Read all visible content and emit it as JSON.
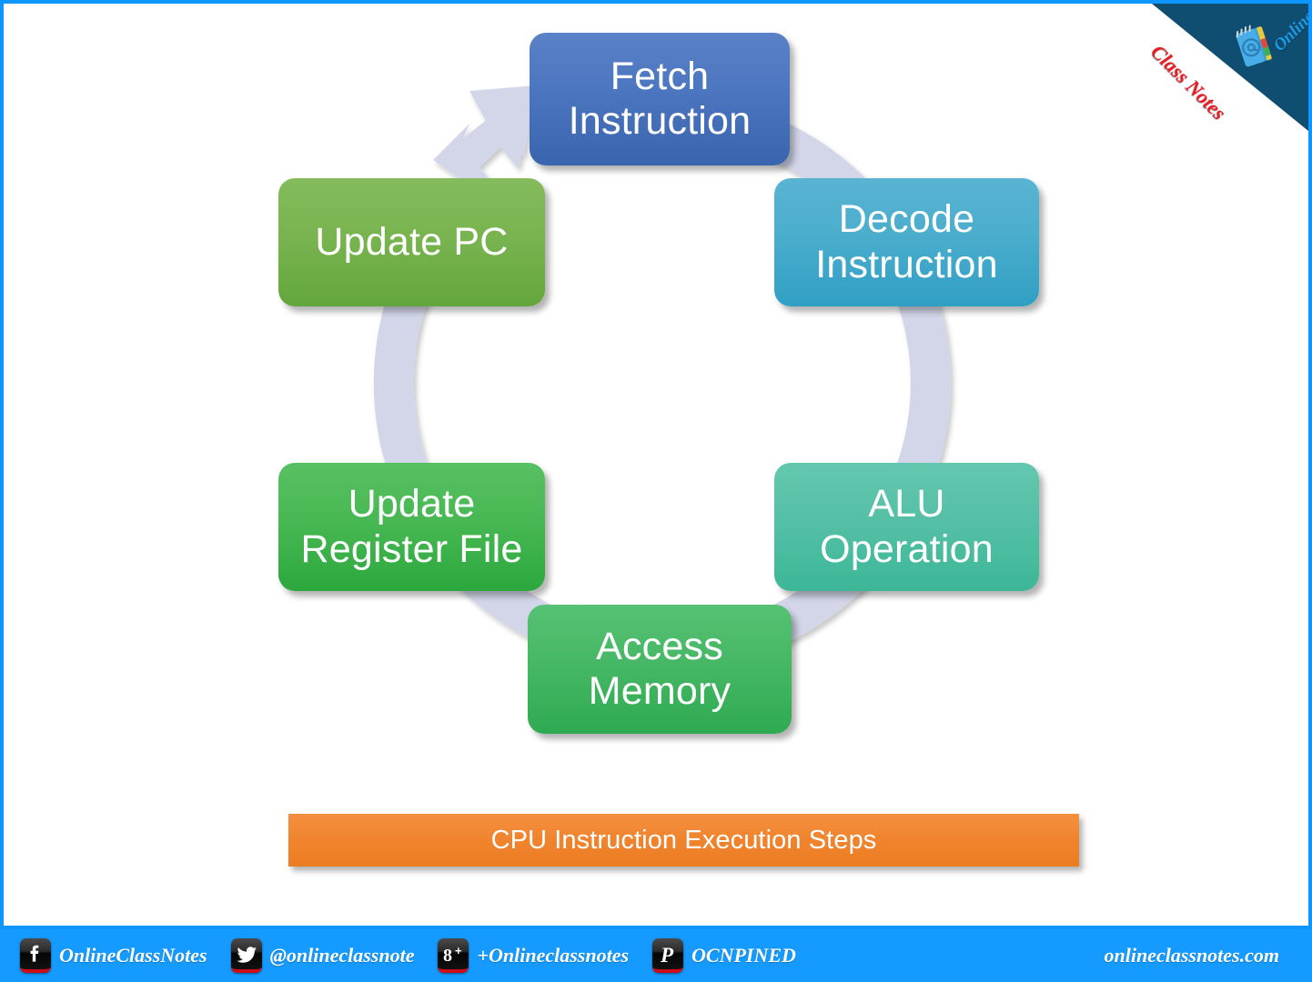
{
  "diagram": {
    "title": "CPU Instruction Execution Steps",
    "ring": {
      "color": "#d2d6e8",
      "direction": "clockwise",
      "arrowhead_target": "Fetch Instruction"
    },
    "steps": [
      {
        "id": "fetch",
        "label": "Fetch\nInstruction",
        "color": "#3965ae",
        "position": "top"
      },
      {
        "id": "decode",
        "label": "Decode\nInstruction",
        "color": "#3f9fc6",
        "position": "top-right"
      },
      {
        "id": "alu",
        "label": "ALU\nOperation",
        "color": "#49bb9c",
        "position": "bottom-right"
      },
      {
        "id": "memory",
        "label": "Access\nMemory",
        "color": "#3aaf5b",
        "position": "bottom"
      },
      {
        "id": "regfile",
        "label": "Update\nRegister File",
        "color": "#35ad46",
        "position": "bottom-left"
      },
      {
        "id": "updatepc",
        "label": "Update PC",
        "color": "#6eab44",
        "position": "top-left"
      }
    ]
  },
  "caption": {
    "text": "CPU Instruction Execution Steps",
    "color": "#ef8030"
  },
  "logo": {
    "word_top": "Online",
    "word_bottom": "Class Notes",
    "ribbon_color": "#104e71",
    "top_color": "#1b9ae8",
    "bottom_color": "#ec1c24"
  },
  "footer": {
    "background": "#159bff",
    "site": "onlineclassnotes.com",
    "social": [
      {
        "icon": "facebook-icon",
        "label": "OnlineClassNotes"
      },
      {
        "icon": "twitter-icon",
        "label": "@onlineclassnote"
      },
      {
        "icon": "googleplus-icon",
        "label": "+Onlineclassnotes"
      },
      {
        "icon": "pinterest-icon",
        "label": "OCNPINED"
      }
    ]
  }
}
